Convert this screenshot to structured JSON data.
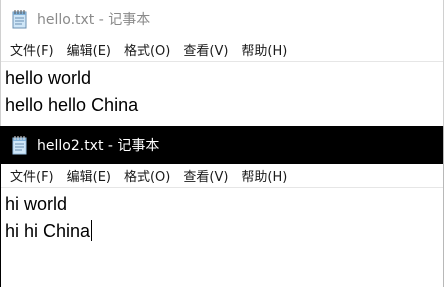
{
  "windows": [
    {
      "title": "hello.txt - 记事本",
      "icon": "notepad-icon",
      "menu": [
        "文件(F)",
        "编辑(E)",
        "格式(O)",
        "查看(V)",
        "帮助(H)"
      ],
      "lines": [
        "hello world",
        "hello hello China"
      ],
      "active": false
    },
    {
      "title": "hello2.txt - 记事本",
      "icon": "notepad-icon",
      "menu": [
        "文件(F)",
        "编辑(E)",
        "格式(O)",
        "查看(V)",
        "帮助(H)"
      ],
      "lines": [
        "hi world",
        "hi hi China"
      ],
      "active": true
    }
  ],
  "colors": {
    "active_titlebar": "#000000",
    "inactive_titlebar": "#ffffff",
    "inactive_title_text": "#8a8a8a"
  }
}
